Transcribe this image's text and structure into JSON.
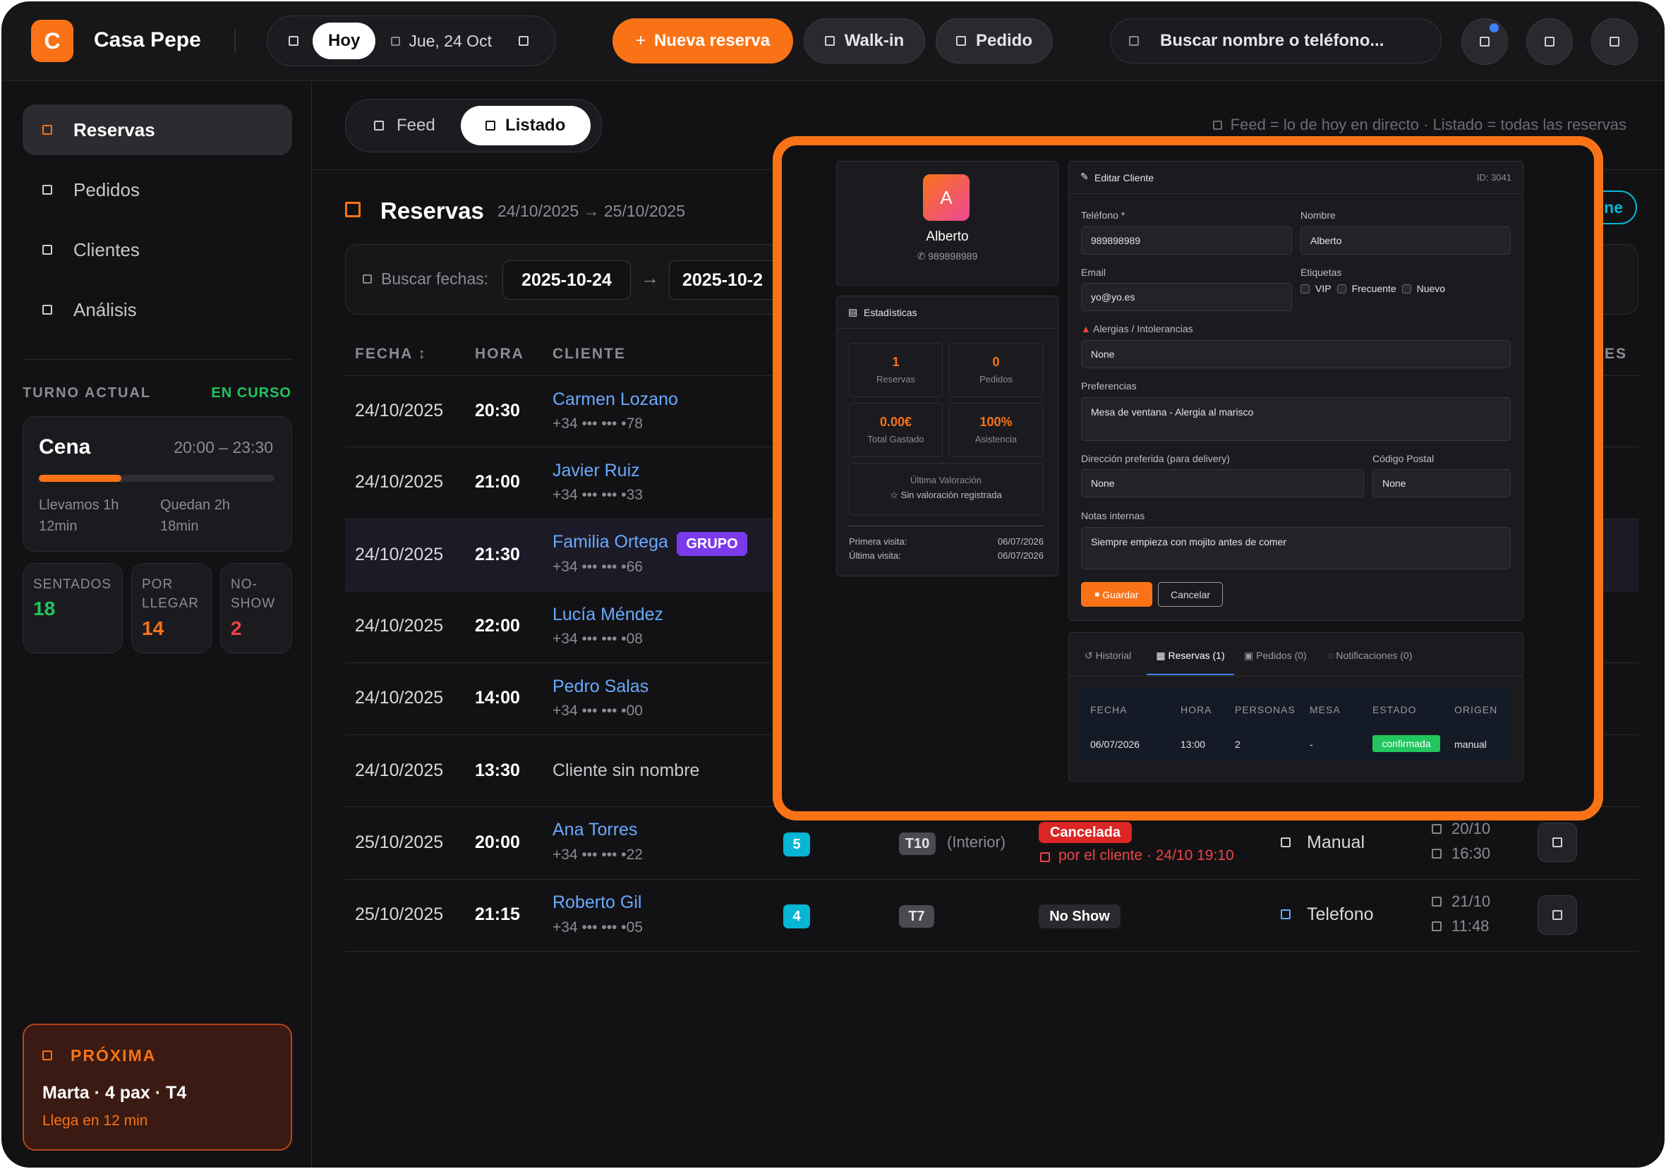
{
  "topbar": {
    "logo_letter": "C",
    "brand": "Casa Pepe",
    "today": "Hoy",
    "date": "Jue, 24 Oct",
    "new_reservation": "Nueva reserva",
    "new_reservation_plus": "+",
    "walk_in": "Walk-in",
    "order": "Pedido",
    "search_placeholder": "Buscar nombre o teléfono..."
  },
  "sidebar": {
    "items": [
      {
        "label": "Reservas"
      },
      {
        "label": "Pedidos"
      },
      {
        "label": "Clientes"
      },
      {
        "label": "Análisis"
      }
    ],
    "shift_title": "TURNO ACTUAL",
    "shift_status": "EN CURSO",
    "shift_name": "Cena",
    "shift_hours": "20:00 – 23:30",
    "shift_progress": 0.35,
    "elapsed": "Llevamos 1h 12min",
    "remaining": "Quedan 2h 18min",
    "counters": [
      {
        "label": "SENTADOS",
        "value": "18",
        "color": "#22c55e"
      },
      {
        "label": "POR LLEGAR",
        "value": "14",
        "color": "#f97316"
      },
      {
        "label": "NO-SHOW",
        "value": "2",
        "color": "#ef4444"
      }
    ],
    "next_title": "PRÓXIMA",
    "next_text": "Marta · 4 pax · T4",
    "next_eta": "Llega en 12 min"
  },
  "main": {
    "view_tabs": [
      "Feed",
      "Listado"
    ],
    "hint": "Feed = lo de hoy en directo · Listado = todas las reservas",
    "title": "Reservas",
    "range": "24/10/2025 → 25/10/2025",
    "search_dates_label": "Buscar fechas:",
    "date_from": "2025-10-24",
    "date_to": "2025-10-2",
    "arrow": "→",
    "right_button_fragment": "ne",
    "columns": {
      "fecha": "FECHA ↕",
      "hora": "HORA",
      "cliente": "CLIENTE",
      "origen_fragment": "ES"
    },
    "rows": [
      {
        "fecha": "24/10/2025",
        "hora": "20:30",
        "cliente": "Carmen Lozano",
        "phone": "+34 ••• ••• •78"
      },
      {
        "fecha": "24/10/2025",
        "hora": "21:00",
        "cliente": "Javier Ruiz",
        "phone": "+34 ••• ••• •33"
      },
      {
        "fecha": "24/10/2025",
        "hora": "21:30",
        "cliente": "Familia Ortega",
        "tag": "GRUPO",
        "phone": "+34 ••• ••• •66"
      },
      {
        "fecha": "24/10/2025",
        "hora": "22:00",
        "cliente": "Lucía Méndez",
        "phone": "+34 ••• ••• •08"
      },
      {
        "fecha": "24/10/2025",
        "hora": "14:00",
        "cliente": "Pedro Salas",
        "phone": "+34 ••• ••• •00"
      },
      {
        "fecha": "24/10/2025",
        "hora": "13:30",
        "cliente": "Cliente sin nombre",
        "phone": ""
      },
      {
        "fecha": "25/10/2025",
        "hora": "20:00",
        "cliente": "Ana Torres",
        "phone": "+34 ••• ••• •22",
        "pax": "5",
        "mesa": "T10",
        "zona": "(Interior)",
        "estado": "Cancelada",
        "estado_detail": "por el cliente · 24/10 19:10",
        "origen": "Manual",
        "created_date": "20/10",
        "created_time": "16:30"
      },
      {
        "fecha": "25/10/2025",
        "hora": "21:15",
        "cliente": "Roberto Gil",
        "phone": "+34 ••• ••• •05",
        "pax": "4",
        "mesa": "T7",
        "zona": "",
        "estado": "No Show",
        "origen": "Telefono",
        "created_date": "21/10",
        "created_time": "11:48"
      }
    ]
  },
  "modal": {
    "avatar_letter": "A",
    "client_name": "Alberto",
    "client_phone": "989898989",
    "stats_title": "Estadísticas",
    "stats": [
      {
        "value": "1",
        "label": "Reservas"
      },
      {
        "value": "0",
        "label": "Pedidos"
      },
      {
        "value": "0.00€",
        "label": "Total Gastado"
      },
      {
        "value": "100%",
        "label": "Asistencia"
      }
    ],
    "rating_title": "Última Valoración",
    "rating_text": "Sin valoración registrada",
    "first_visit_label": "Primera visita:",
    "first_visit": "06/07/2026",
    "last_visit_label": "Última visita:",
    "last_visit": "06/07/2026",
    "edit_title": "Editar Cliente",
    "client_id": "ID: 3041",
    "phone_label": "Teléfono *",
    "phone_value": "989898989",
    "name_label": "Nombre",
    "name_value": "Alberto",
    "email_label": "Email",
    "email_value": "yo@yo.es",
    "tags_label": "Etiquetas",
    "tags": [
      "VIP",
      "Frecuente",
      "Nuevo"
    ],
    "allergies_label": "Alergias / Intolerancias",
    "allergies_value": "None",
    "preferences_label": "Preferencias",
    "preferences_value": "Mesa de ventana - Alergia al marisco",
    "address_label": "Dirección preferida (para delivery)",
    "address_value": "None",
    "postal_label": "Código Postal",
    "postal_value": "None",
    "notes_label": "Notas internas",
    "notes_value": "Siempre empieza con mojito antes de comer",
    "save": "Guardar",
    "cancel": "Cancelar",
    "tabs": [
      "Historial",
      "Reservas (1)",
      "Pedidos (0)",
      "Notificaciones (0)"
    ],
    "table_headers": [
      "FECHA",
      "HORA",
      "PERSONAS",
      "MESA",
      "ESTADO",
      "ORIGEN"
    ],
    "table_rows": [
      {
        "fecha": "06/07/2026",
        "hora": "13:00",
        "personas": "2",
        "mesa": "-",
        "estado": "confirmada",
        "origen": "manual"
      }
    ]
  },
  "colors": {
    "accent": "#f97316",
    "link": "#6aa9ff",
    "purple": "#7c3aed",
    "danger": "#ef4444",
    "success": "#22c55e"
  }
}
